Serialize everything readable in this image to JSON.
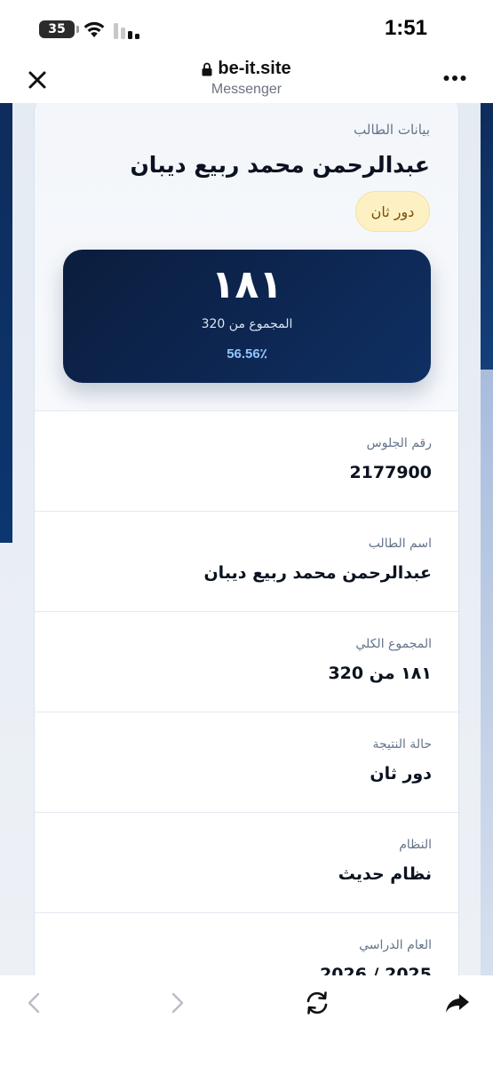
{
  "status_bar": {
    "battery_level": "35",
    "time": "1:51",
    "icons": [
      "battery-icon",
      "wifi-icon",
      "signal-icon"
    ]
  },
  "browser": {
    "url": "be-it.site",
    "subtitle": "Messenger",
    "icons": [
      "close-icon",
      "lock-icon",
      "more-icon"
    ]
  },
  "header": {
    "section_label": "بيانات الطالب",
    "student_name": "عبدالرحمن محمد ربيع ديبان",
    "status_badge": "دور ثان"
  },
  "score": {
    "value": "١٨١",
    "subtitle": "المجموع من 320",
    "percentage": "56.56٪"
  },
  "details": [
    {
      "label": "رقم الجلوس",
      "value": "2177900"
    },
    {
      "label": "اسم الطالب",
      "value": "عبدالرحمن محمد ربيع ديبان"
    },
    {
      "label": "المجموع الكلي",
      "value": "١٨١ من 320"
    },
    {
      "label": "حالة النتيجة",
      "value": "دور ثان"
    },
    {
      "label": "النظام",
      "value": "نظام حديث"
    },
    {
      "label": "العام الدراسي",
      "value": "2026 / 2025"
    }
  ],
  "toolbar": {
    "icons": [
      "back-icon",
      "forward-icon",
      "reload-icon",
      "share-icon"
    ]
  },
  "colors": {
    "score_box": "#0f2f63",
    "badge_bg": "#fdf1c4",
    "badge_text": "#7a4d05",
    "percentage": "#93c5fd"
  }
}
